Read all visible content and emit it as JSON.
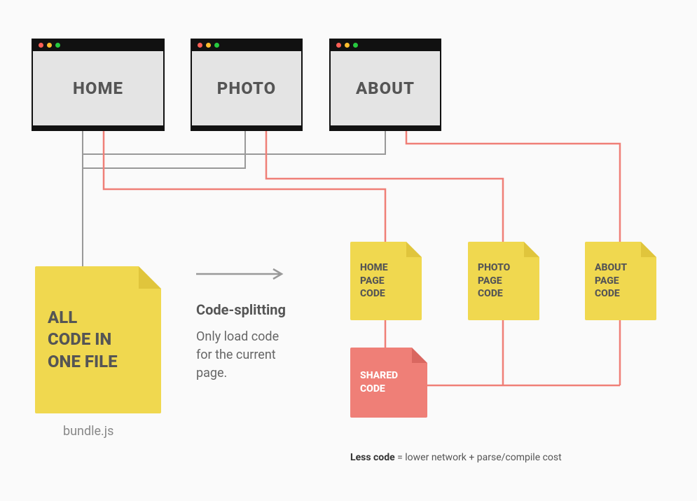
{
  "browsers": {
    "home": "HOME",
    "photo": "PHOTO",
    "about": "ABOUT"
  },
  "bundle": {
    "line1": "ALL",
    "line2": "CODE IN",
    "line3": "ONE FILE",
    "label": "bundle.js"
  },
  "center": {
    "heading": "Code-splitting",
    "desc_line1": "Only load code",
    "desc_line2": "for the current",
    "desc_line3": "page."
  },
  "chunks": {
    "home": {
      "l1": "HOME",
      "l2": "PAGE",
      "l3": "CODE"
    },
    "photo": {
      "l1": "PHOTO",
      "l2": "PAGE",
      "l3": "CODE"
    },
    "about": {
      "l1": "ABOUT",
      "l2": "PAGE",
      "l3": "CODE"
    },
    "shared": {
      "l1": "SHARED",
      "l2": "CODE"
    }
  },
  "footnote": {
    "bold": "Less code",
    "rest": " = lower network + parse/compile cost"
  }
}
